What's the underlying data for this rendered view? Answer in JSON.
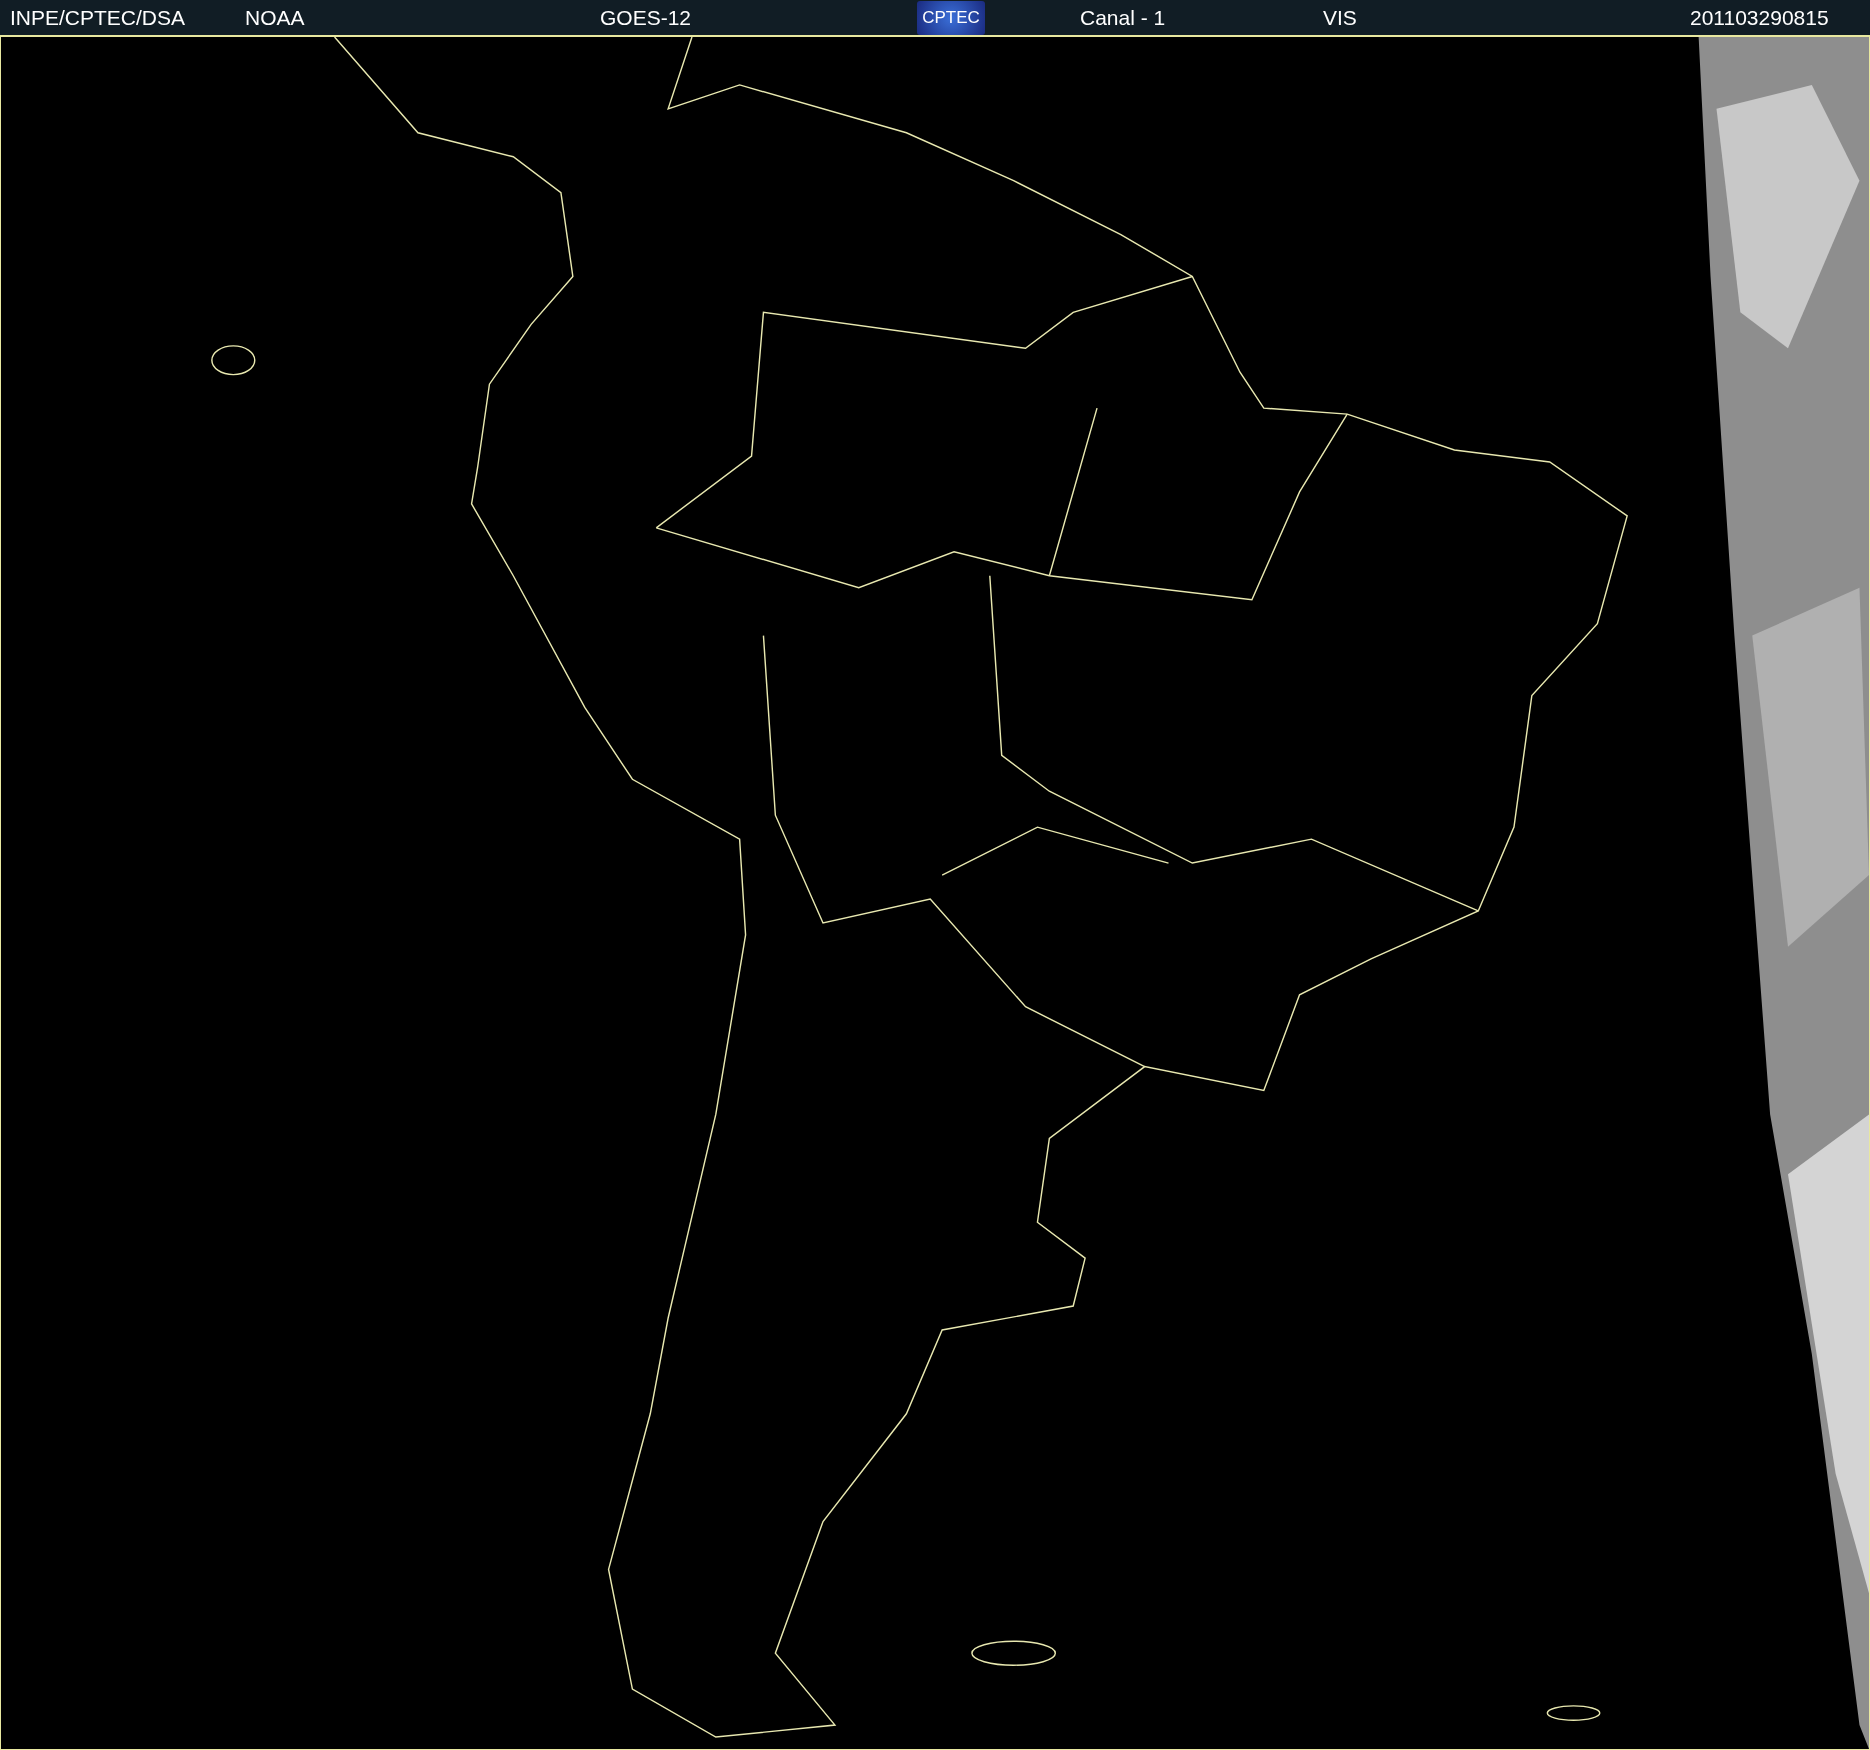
{
  "header": {
    "source": "INPE/CPTEC/DSA",
    "agency": "NOAA",
    "satellite": "GOES-12",
    "logo": "CPTEC",
    "channel": "Canal - 1",
    "band": "VIS",
    "timestamp": "201103290815"
  }
}
